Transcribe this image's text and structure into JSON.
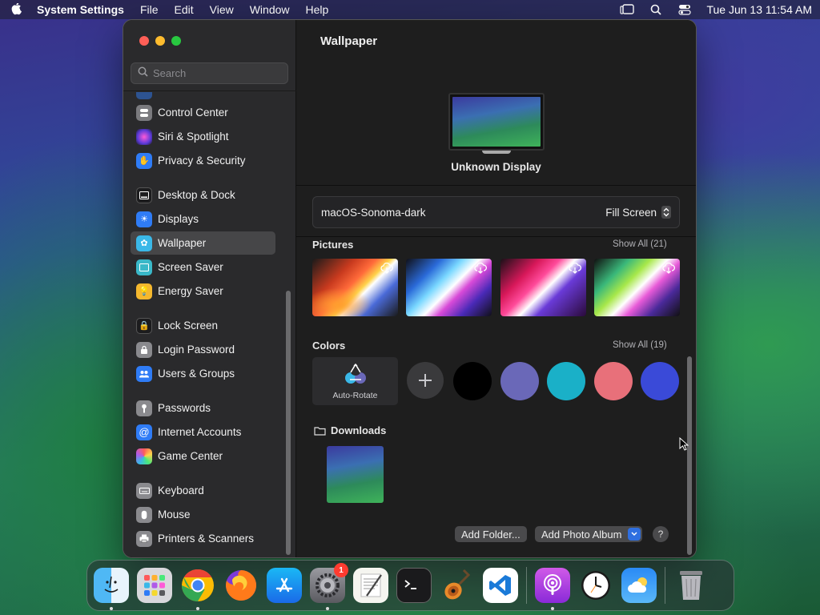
{
  "menubar": {
    "app_name": "System Settings",
    "menus": [
      "File",
      "Edit",
      "View",
      "Window",
      "Help"
    ],
    "clock": "Tue Jun 13  11:54 AM"
  },
  "sidebar": {
    "search_placeholder": "Search",
    "items": [
      {
        "label": "Control Center",
        "icon": "control-center-icon",
        "color": "#7a7a7e"
      },
      {
        "label": "Siri & Spotlight",
        "icon": "siri-icon",
        "color": "#b03ad8"
      },
      {
        "label": "Privacy & Security",
        "icon": "hand-icon",
        "color": "#2f7cf6"
      },
      {
        "label": "Desktop & Dock",
        "icon": "dock-icon",
        "color": "#1c1c1e"
      },
      {
        "label": "Displays",
        "icon": "sun-icon",
        "color": "#2f7cf6"
      },
      {
        "label": "Wallpaper",
        "icon": "flower-icon",
        "color": "#3ab8e8"
      },
      {
        "label": "Screen Saver",
        "icon": "screen-saver-icon",
        "color": "#3ab8c8"
      },
      {
        "label": "Energy Saver",
        "icon": "battery-icon",
        "color": "#f5b82e"
      },
      {
        "label": "Lock Screen",
        "icon": "lock-icon",
        "color": "#1c1c1e"
      },
      {
        "label": "Login Password",
        "icon": "padlock-icon",
        "color": "#8a8a8e"
      },
      {
        "label": "Users & Groups",
        "icon": "users-icon",
        "color": "#2f7cf6"
      },
      {
        "label": "Passwords",
        "icon": "key-icon",
        "color": "#8a8a8e"
      },
      {
        "label": "Internet Accounts",
        "icon": "at-icon",
        "color": "#2f7cf6"
      },
      {
        "label": "Game Center",
        "icon": "game-center-icon",
        "color": "#e8e8e8"
      },
      {
        "label": "Keyboard",
        "icon": "keyboard-icon",
        "color": "#8a8a8e"
      },
      {
        "label": "Mouse",
        "icon": "mouse-icon",
        "color": "#8a8a8e"
      },
      {
        "label": "Printers & Scanners",
        "icon": "printer-icon",
        "color": "#8a8a8e"
      }
    ],
    "selected": "Wallpaper"
  },
  "main": {
    "title": "Wallpaper",
    "display_name": "Unknown Display",
    "wallpaper_name": "macOS-Sonoma-dark",
    "fill_mode": "Fill Screen",
    "pictures": {
      "title": "Pictures",
      "show_all": "Show All (21)"
    },
    "colors": {
      "title": "Colors",
      "show_all": "Show All (19)",
      "auto_rotate": "Auto-Rotate",
      "swatches": [
        "#000000",
        "#6a68b8",
        "#1ab0c8",
        "#e8707a",
        "#3a4ad8"
      ]
    },
    "downloads": {
      "title": "Downloads"
    },
    "buttons": {
      "add_folder": "Add Folder...",
      "add_photo_album": "Add Photo Album",
      "help": "?"
    }
  },
  "dock": {
    "apps": [
      "Finder",
      "Launchpad",
      "Chrome",
      "Firefox",
      "App Store",
      "System Settings",
      "TextEdit",
      "Terminal",
      "GarageBand",
      "VS Code",
      "Podcasts",
      "Clock",
      "Weather",
      "Trash"
    ],
    "settings_badge": "1"
  }
}
